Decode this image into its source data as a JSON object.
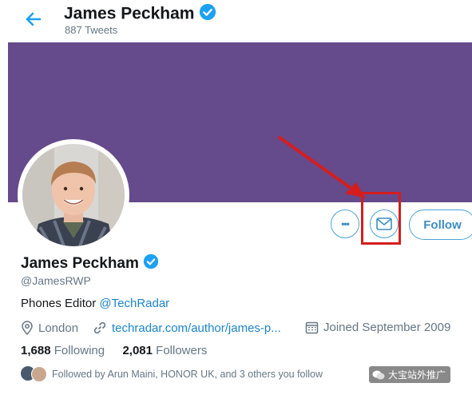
{
  "header": {
    "name": "James Peckham",
    "tweet_count": "887 Tweets"
  },
  "profile": {
    "name": "James Peckham",
    "handle": "@JamesRWP",
    "bio_text": "Phones Editor ",
    "bio_link": "@TechRadar",
    "location": "London",
    "website": "techradar.com/author/james-p...",
    "joined": "Joined September 2009",
    "following_count": "1,688",
    "following_label": "Following",
    "followers_count": "2,081",
    "followers_label": "Followers",
    "followed_by": "Followed by Arun Maini, HONOR UK, and 3 others you follow"
  },
  "actions": {
    "more_label": "•••",
    "follow_label": "Follow"
  },
  "watermark": {
    "text": "大宝站外推广"
  },
  "colors": {
    "banner": "#654a8c",
    "accent": "#1da1f2",
    "highlight": "#d41e1e"
  }
}
